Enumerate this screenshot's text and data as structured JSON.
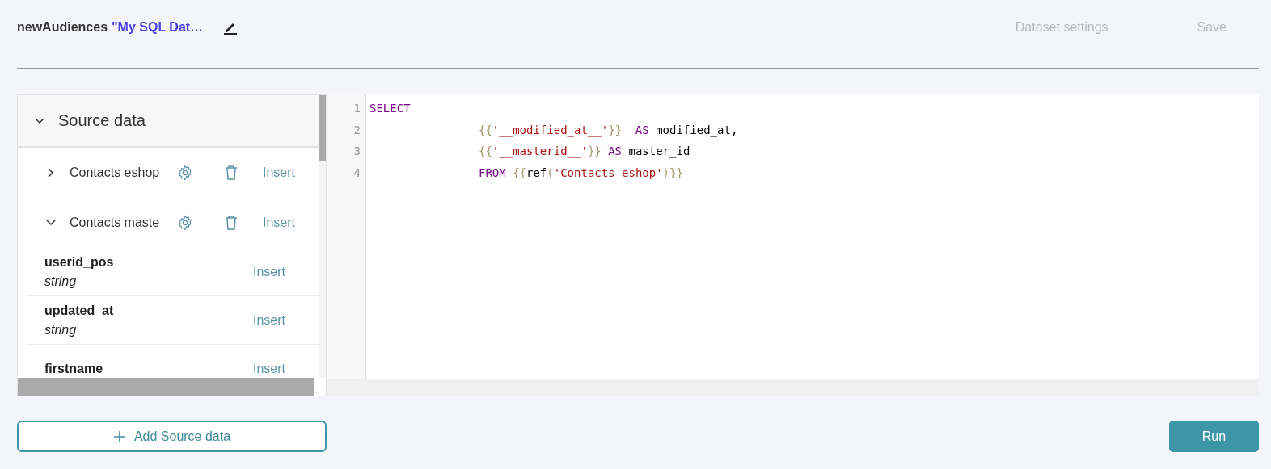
{
  "header": {
    "title": "newAudiences",
    "dataset_name": "\"My SQL Dat…",
    "actions": [
      {
        "label": "Dataset settings",
        "disabled": true
      },
      {
        "label": "Save",
        "disabled": true
      }
    ]
  },
  "source_panel": {
    "title": "Source data",
    "expanded": true,
    "sources": [
      {
        "name": "Contacts eshop",
        "expanded": false,
        "insert": "Insert"
      },
      {
        "name": "Contacts maste",
        "expanded": true,
        "insert": "Insert",
        "fields": [
          {
            "name": "userid_pos",
            "type": "string",
            "insert": "Insert"
          },
          {
            "name": "updated_at",
            "type": "string",
            "insert": "Insert"
          },
          {
            "name": "firstname",
            "insert": "Insert"
          }
        ]
      }
    ]
  },
  "editor": {
    "lines": [
      {
        "number": "1",
        "indented": false,
        "tokens": [
          {
            "kind": "keyword",
            "text": "SELECT"
          }
        ]
      },
      {
        "number": "2",
        "indented": true,
        "tokens": [
          {
            "kind": "brace",
            "text": "{{"
          },
          {
            "kind": "string",
            "text": "'__modified_at__'"
          },
          {
            "kind": "brace",
            "text": "}}"
          },
          {
            "kind": "keyword",
            "text": "  AS"
          },
          {
            "kind": "plain",
            "text": " modified_at,"
          }
        ]
      },
      {
        "number": "3",
        "indented": true,
        "tokens": [
          {
            "kind": "brace",
            "text": "{{"
          },
          {
            "kind": "string",
            "text": "'__masterid__'"
          },
          {
            "kind": "brace",
            "text": "}}"
          },
          {
            "kind": "keyword",
            "text": " AS"
          },
          {
            "kind": "plain",
            "text": " master_id"
          }
        ]
      },
      {
        "number": "4",
        "indented": true,
        "tokens": [
          {
            "kind": "keyword",
            "text": "FROM"
          },
          {
            "kind": "brace",
            "text": " {{"
          },
          {
            "kind": "plain",
            "text": "ref"
          },
          {
            "kind": "brace",
            "text": "("
          },
          {
            "kind": "string",
            "text": "'Contacts eshop'"
          },
          {
            "kind": "brace",
            "text": ")}}"
          }
        ]
      }
    ]
  },
  "footer": {
    "add_button": "Add Source data",
    "run_button": "Run"
  }
}
